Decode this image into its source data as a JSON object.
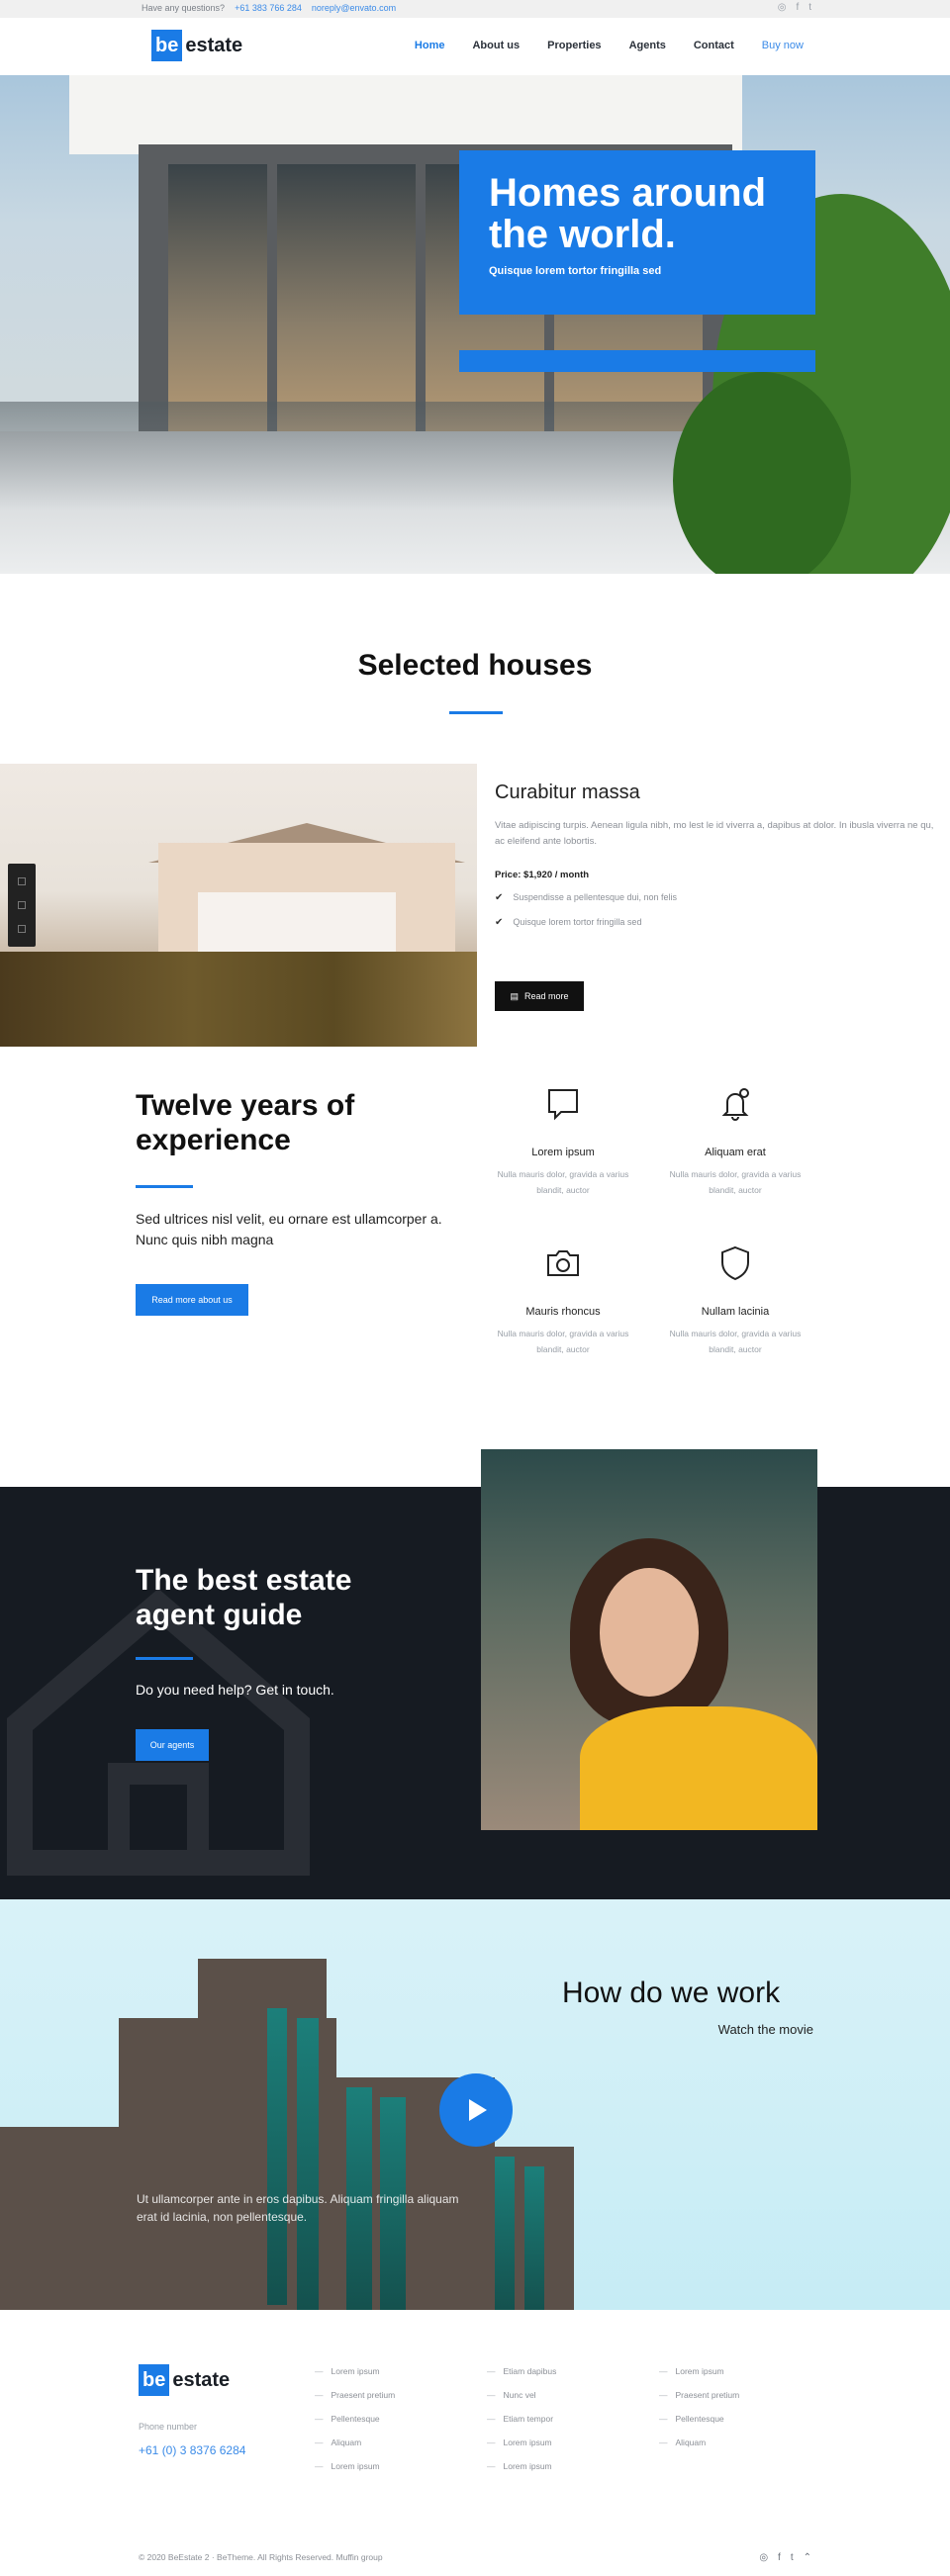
{
  "topbar": {
    "question": "Have any questions?",
    "phone": "+61 383 766 284",
    "email": "noreply@envato.com"
  },
  "brand": {
    "box": "be",
    "word": "estate",
    "accent": "#1a7be6"
  },
  "nav": {
    "items": [
      "Home",
      "About us",
      "Properties",
      "Agents",
      "Contact"
    ],
    "buy": "Buy now",
    "active_index": 0
  },
  "hero": {
    "headline": "Homes around the world.",
    "subline": "Quisque lorem tortor fringilla sed"
  },
  "selected": {
    "title": "Selected houses",
    "house_title": "Curabitur massa",
    "description": "Vitae adipiscing turpis. Aenean ligula nibh, mo lest le id viverra a, dapibus at dolor. In ibusla viverra ne qu, ac eleifend ante lobortis.",
    "price": "Price: $1,920 / month",
    "features": [
      "Suspendisse a pellentesque dui, non felis",
      "Quisque lorem tortor fringilla sed"
    ],
    "button": "Read more"
  },
  "experience": {
    "title": "Twelve years of experience",
    "text": "Sed ultrices nisl velit, eu ornare est ullamcorper a. Nunc quis nibh magna",
    "button": "Read more about us",
    "features": [
      {
        "name": "Lorem ipsum",
        "icon": "chat-icon",
        "text": "Nulla mauris dolor, gravida a varius blandit, auctor"
      },
      {
        "name": "Aliquam erat",
        "icon": "bell-icon",
        "text": "Nulla mauris dolor, gravida a varius blandit, auctor"
      },
      {
        "name": "Mauris rhoncus",
        "icon": "camera-icon",
        "text": "Nulla mauris dolor, gravida a varius blandit, auctor"
      },
      {
        "name": "Nullam lacinia",
        "icon": "shield-icon",
        "text": "Nulla mauris dolor, gravida a varius blandit, auctor"
      }
    ]
  },
  "agent": {
    "title": "The best estate agent guide",
    "text": "Do you need help? Get in touch.",
    "button": "Our agents"
  },
  "work": {
    "title": "How do we work",
    "subtitle": "Watch the movie",
    "caption": "Ut ullamcorper ante in eros dapibus. Aliquam fringilla aliquam erat id lacinia, non pellentesque."
  },
  "footer": {
    "phone_label": "Phone number",
    "phone": "+61 (0) 3 8376 6284",
    "columns": [
      [
        "Lorem ipsum",
        "Praesent pretium",
        "Pellentesque",
        "Aliquam",
        "Lorem ipsum"
      ],
      [
        "Etiam dapibus",
        "Nunc vel",
        "Etiam tempor",
        "Lorem ipsum",
        "Lorem ipsum"
      ],
      [
        "Lorem ipsum",
        "Praesent pretium",
        "Pellentesque",
        "Aliquam"
      ]
    ],
    "copyright": "© 2020 BeEstate 2 · BeTheme. All Rights Reserved. Muffin group"
  }
}
